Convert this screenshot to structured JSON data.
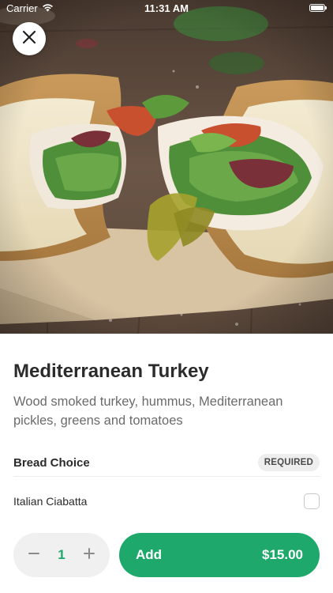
{
  "status_bar": {
    "carrier": "Carrier",
    "time": "11:31 AM"
  },
  "hero": {
    "alt_icon": "sandwich-photo"
  },
  "item": {
    "title": "Mediterranean Turkey",
    "description": "Wood smoked turkey, hummus, Mediterranean pickles, greens and tomatoes"
  },
  "options": {
    "section_title": "Bread Choice",
    "badge": "REQUIRED",
    "choices": [
      {
        "label": "Italian Ciabatta",
        "checked": false
      }
    ]
  },
  "cart": {
    "quantity": "1",
    "add_label": "Add",
    "price": "$15.00"
  },
  "colors": {
    "accent": "#1ea86b",
    "title": "#2b2b2b",
    "description": "#6b6b6b",
    "badge_bg": "#eeeeee"
  },
  "icons": {
    "close": "close-icon",
    "minus": "minus-icon",
    "plus": "plus-icon",
    "wifi": "wifi-icon",
    "battery": "battery-icon"
  }
}
